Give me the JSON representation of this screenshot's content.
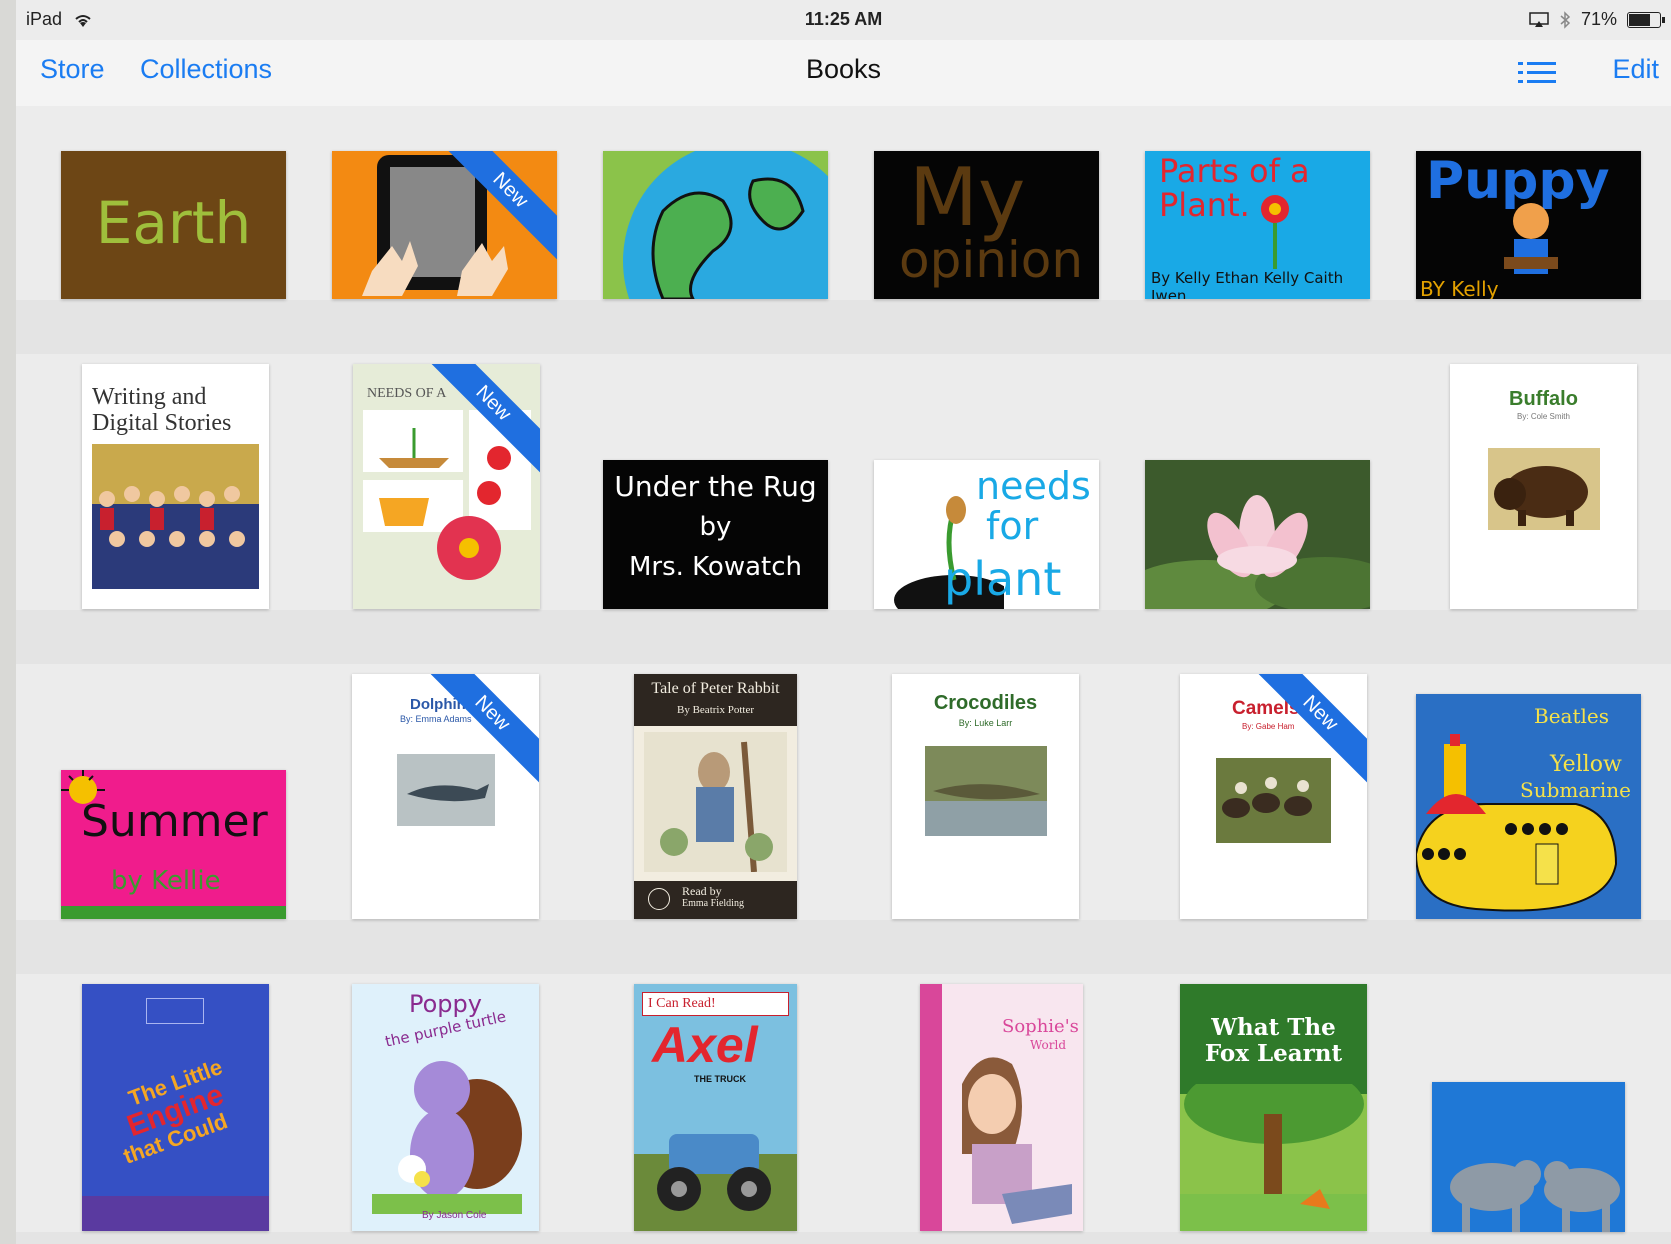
{
  "status_bar": {
    "device": "iPad",
    "time": "11:25 AM",
    "battery_percent": "71%",
    "battery_level": 0.71,
    "icons": [
      "wifi-icon",
      "airplay-icon",
      "bluetooth-icon",
      "battery-icon"
    ]
  },
  "nav": {
    "store_label": "Store",
    "collections_label": "Collections",
    "title": "Books",
    "edit_label": "Edit",
    "list_icon": "list-view-icon"
  },
  "colors": {
    "accent": "#1a7cf2",
    "new_ribbon": "#1f6fe0",
    "shelf_background": "#ececec"
  },
  "new_badge": "New",
  "books": {
    "earth": {
      "title": "Earth"
    },
    "tablet_hands": {
      "new": true
    },
    "globe": {},
    "my_opinion": {
      "title": "My",
      "subtitle": "opinion"
    },
    "parts_of_plant": {
      "title": "Parts of a Plant.",
      "byline": "By Kelly  Ethan Kelly Caith Iwen"
    },
    "puppy": {
      "title": "Puppy",
      "byline": "BY Kelly"
    },
    "writing_digital": {
      "title_line1": "Writing and",
      "title_line2": "Digital Stories"
    },
    "needs_of": {
      "title": "NEEDS OF A",
      "new": true
    },
    "under_rug": {
      "line1": "Under the Rug",
      "line2": "by",
      "line3": "Mrs. Kowatch"
    },
    "needs_for_plant": {
      "line1": "needs",
      "line2": "for",
      "line3": "plant"
    },
    "lotus": {},
    "buffalo": {
      "title": "Buffalo",
      "byline": "By: Cole Smith"
    },
    "summer": {
      "title": "Summer",
      "byline": "by Kellie"
    },
    "dolphins": {
      "title": "Dolphins",
      "byline": "By: Emma Adams",
      "new": true
    },
    "peter_rabbit": {
      "title": "Tale of Peter Rabbit",
      "author": "By Beatrix Potter",
      "narrator_line1": "Read by",
      "narrator_line2": "Emma Fielding"
    },
    "crocodiles": {
      "title": "Crocodiles",
      "byline": "By: Luke Larr"
    },
    "camels": {
      "title": "Camels",
      "byline": "By: Gabe Ham",
      "new": true
    },
    "beatles": {
      "title1": "Beatles",
      "title2": "Yellow",
      "title3": "Submarine"
    },
    "little_engine": {
      "title_line1": "The Little",
      "title_line2": "Engine",
      "title_line3": "that Could"
    },
    "poppy": {
      "title": "Poppy",
      "subtitle": "the purple turtle",
      "byline": "By Jason Cole"
    },
    "axel": {
      "series": "I Can Read!",
      "title": "Axel",
      "subtitle": "THE TRUCK"
    },
    "sophie": {
      "title": "Sophie's",
      "subtitle": "World"
    },
    "fox": {
      "title_line1": "What The",
      "title_line2": "Fox Learnt"
    },
    "hippos": {}
  }
}
